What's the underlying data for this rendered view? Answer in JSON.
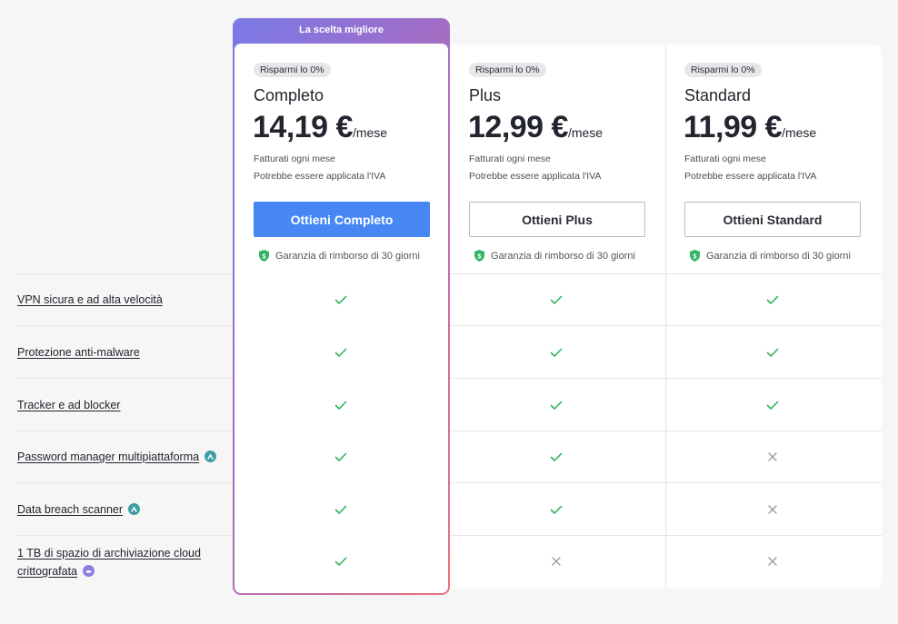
{
  "featured_label": "La scelta migliore",
  "colors": {
    "accent_blue": "#4687f4",
    "check_green": "#2fb15a",
    "cross_gray": "#9a9ca3",
    "shield_green": "#33b567",
    "icon_teal": "#3f9fa0",
    "icon_purple": "#8f7ee0"
  },
  "plans": [
    {
      "badge": "Risparmi lo 0%",
      "name": "Completo",
      "price": "14,19 €",
      "period": "/mese",
      "billing_note": "Fatturati ogni mese",
      "vat_note": "Potrebbe essere applicata l'IVA",
      "cta": "Ottieni Completo",
      "guarantee": "Garanzia di rimborso di 30 giorni"
    },
    {
      "badge": "Risparmi lo 0%",
      "name": "Plus",
      "price": "12,99 €",
      "period": "/mese",
      "billing_note": "Fatturati ogni mese",
      "vat_note": "Potrebbe essere applicata l'IVA",
      "cta": "Ottieni Plus",
      "guarantee": "Garanzia di rimborso di 30 giorni"
    },
    {
      "badge": "Risparmi lo 0%",
      "name": "Standard",
      "price": "11,99 €",
      "period": "/mese",
      "billing_note": "Fatturati ogni mese",
      "vat_note": "Potrebbe essere applicata l'IVA",
      "cta": "Ottieni Standard",
      "guarantee": "Garanzia di rimborso di 30 giorni"
    }
  ],
  "features": [
    {
      "label": "VPN sicura e ad alta velocità",
      "icon": "",
      "included": [
        true,
        true,
        true
      ]
    },
    {
      "label": "Protezione anti-malware",
      "icon": "",
      "included": [
        true,
        true,
        true
      ]
    },
    {
      "label": "Tracker e ad blocker",
      "icon": "",
      "included": [
        true,
        true,
        true
      ]
    },
    {
      "label": "Password manager multipiattaforma",
      "icon": "nordpass-icon",
      "included": [
        true,
        true,
        false
      ]
    },
    {
      "label": "Data breach scanner",
      "icon": "nordpass-icon",
      "included": [
        true,
        true,
        false
      ]
    },
    {
      "label_line1": "1 TB di spazio di archiviazione cloud",
      "label_line2": "crittografata",
      "icon": "nordlocker-icon",
      "included": [
        true,
        false,
        false
      ]
    }
  ]
}
